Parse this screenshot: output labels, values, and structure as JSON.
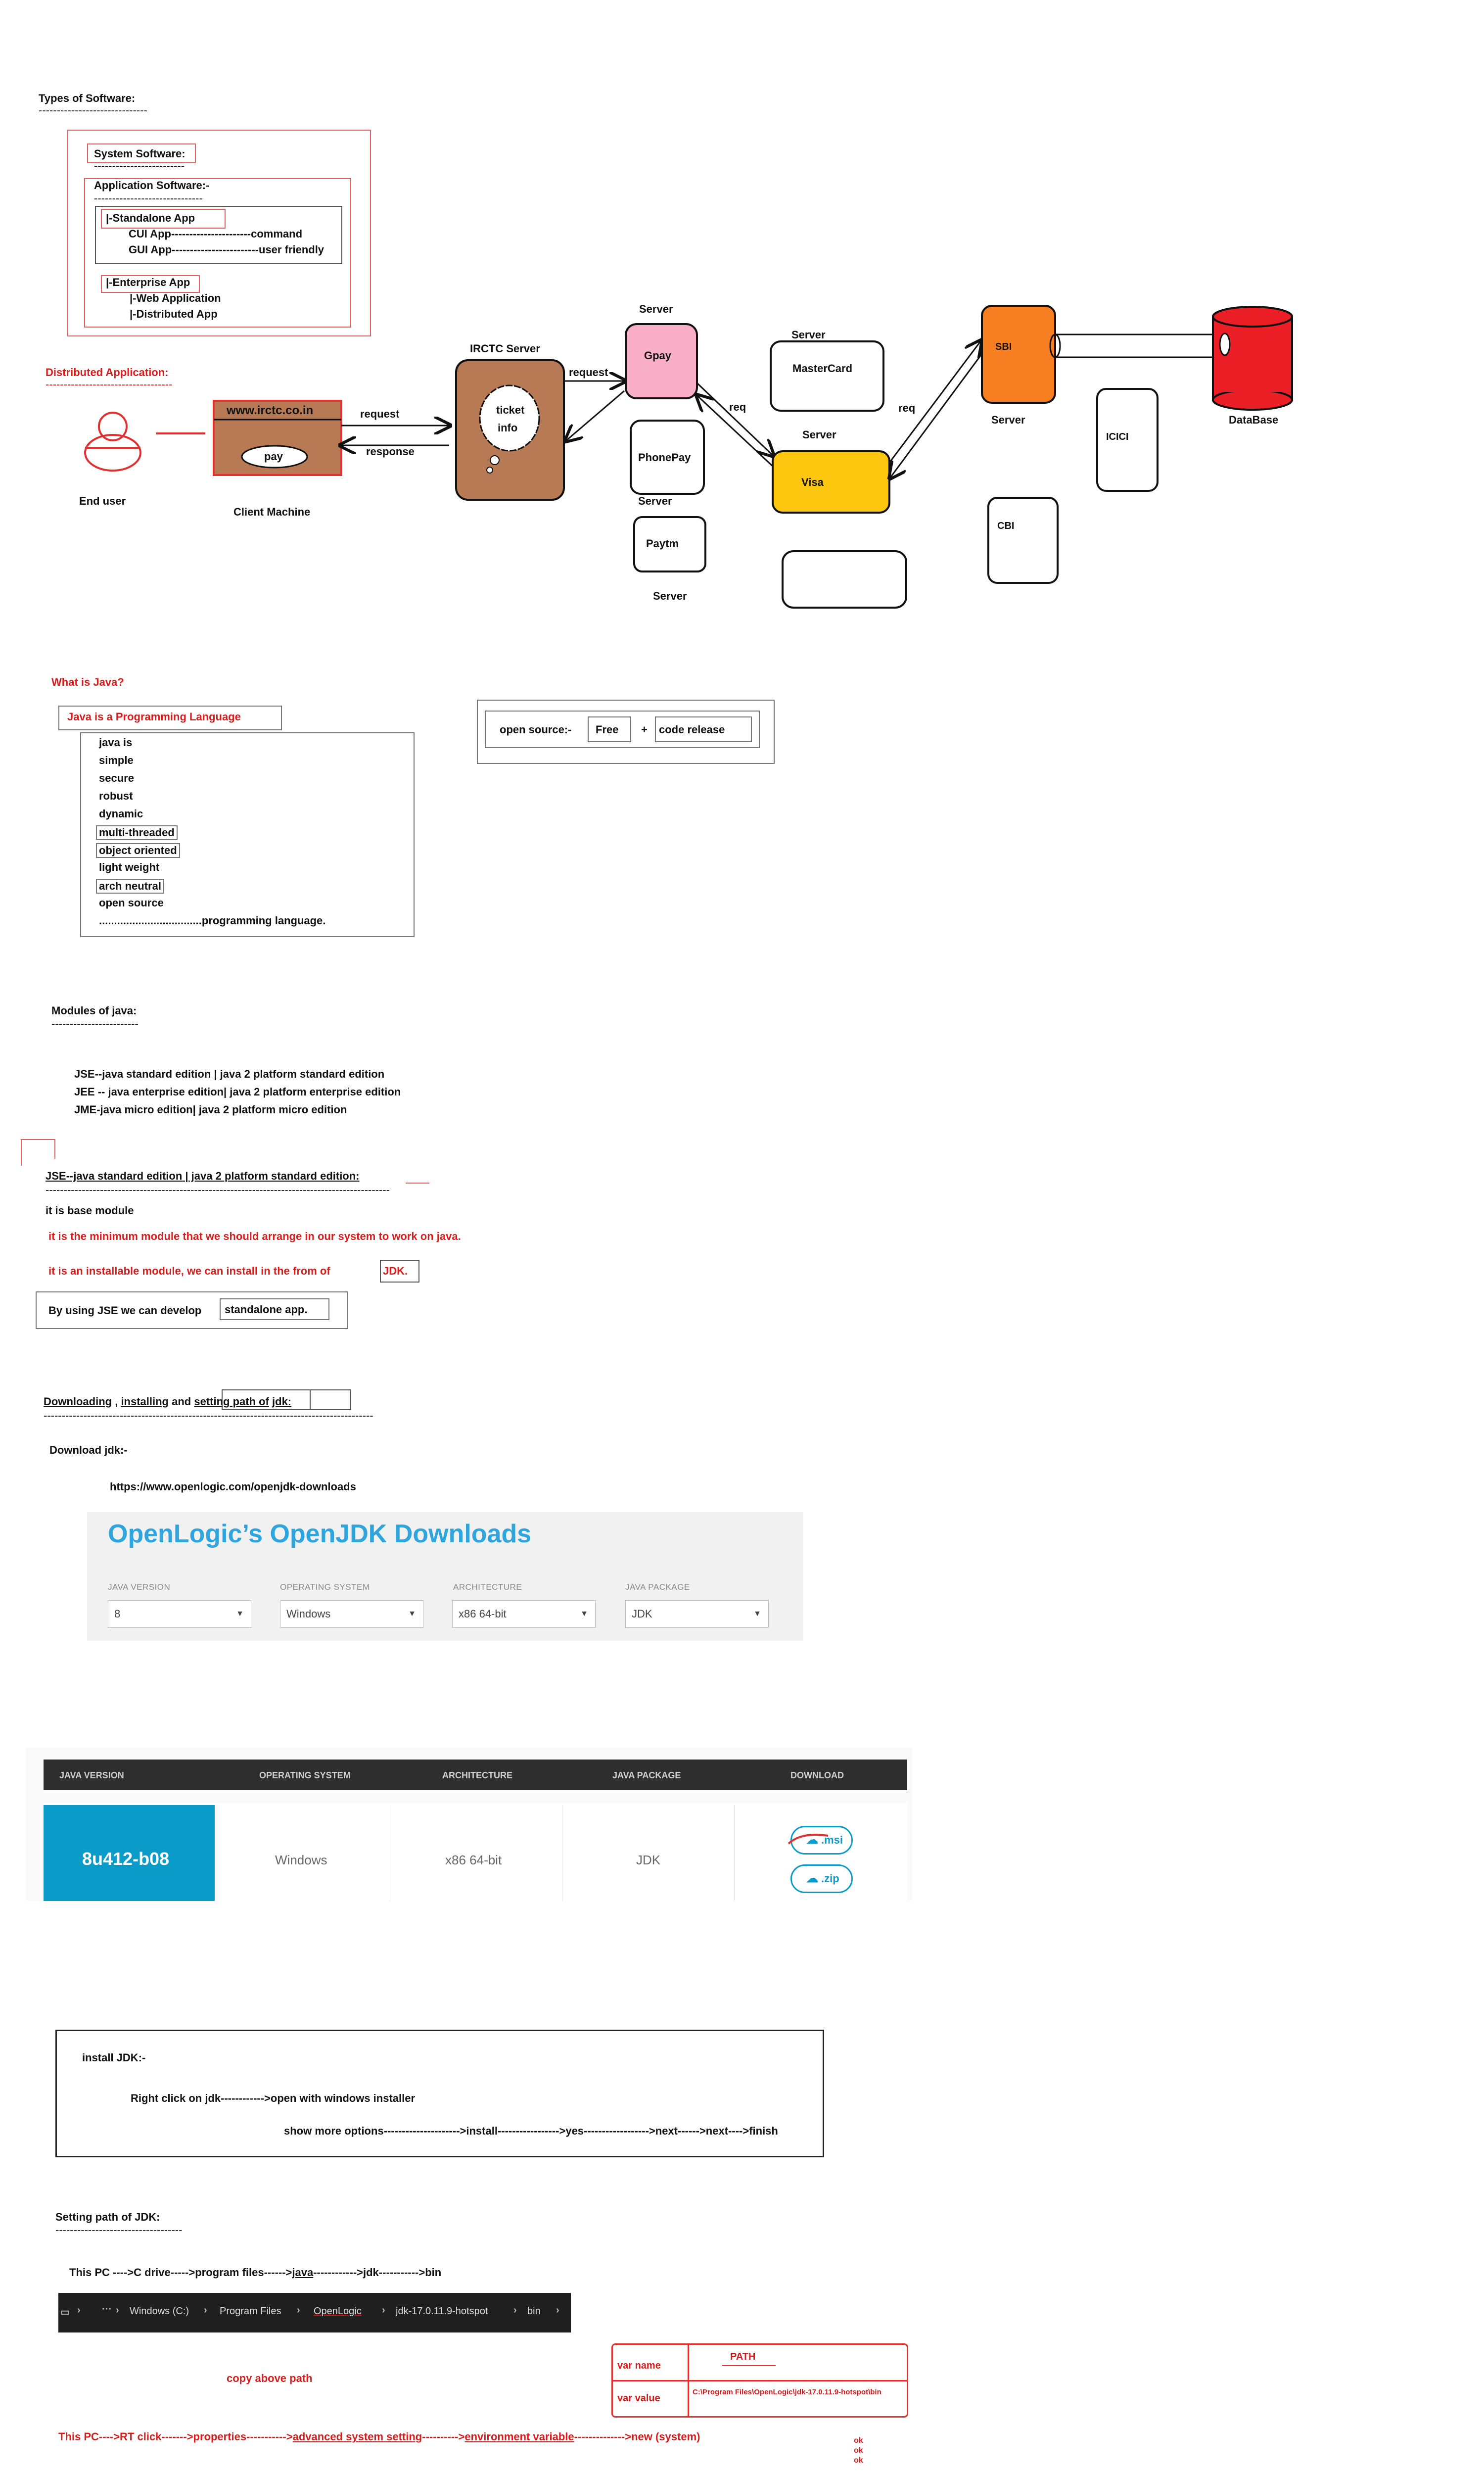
{
  "types": {
    "title": "Types of Software:",
    "dashes": "------------------------------",
    "system": "System Software:",
    "system_dashes": "-------------------------",
    "application": "Application Software:-",
    "app_dashes": "------------------------------",
    "standalone": "|-Standalone App",
    "cui": "CUI  App----------------------command",
    "gui": "GUI App------------------------user friendly",
    "enterprise": "|-Enterprise App",
    "web": "|-Web Application",
    "distributed": "|-Distributed App"
  },
  "distributed": {
    "title": "Distributed Application:",
    "dashes": "-----------------------------------",
    "end_user": "End user",
    "client_machine": "Client Machine",
    "url": "www.irctc.co.in",
    "pay": "pay",
    "request": "request",
    "response": "response",
    "irctc_server": "IRCTC Server",
    "ticket": "ticket",
    "info": "info",
    "request2": "request",
    "server": "Server",
    "gpay": "Gpay",
    "phonepay": "PhonePay",
    "paytm": "Paytm",
    "mastercard": "MasterCard",
    "visa": "Visa",
    "req": "req",
    "sbi": "SBI",
    "icici": "ICICI",
    "cbi": "CBI",
    "database": "DataBase"
  },
  "java": {
    "title": "What is Java?",
    "is_lang": "Java is a Programming  Language",
    "features": [
      "java is",
      "simple",
      "secure",
      "robust",
      "dynamic",
      "multi-threaded",
      "object oriented",
      "light weight",
      "arch neutral",
      "open source",
      "..................................programming language."
    ],
    "open_source": "open source:-",
    "free": "Free",
    "plus": "+",
    "code_release": "code release"
  },
  "modules": {
    "title": "Modules of java:",
    "dashes": "------------------------",
    "jse": "JSE--java standard edition  |  java 2 platform standard edition",
    "jee": "JEE -- java enterprise edition|  java 2 platform  enterprise edition",
    "jme": "JME-java micro edition|  java 2 platform micro edition"
  },
  "jse": {
    "title": "JSE--java standard edition  |  java 2 platform standard edition:",
    "dashes": "-----------------------------------------------------------------------------------------------",
    "base": "it is base module",
    "min": "it  is the minimum module that we should arrange in our system to work on java.",
    "installable": "it is an installable module, we can install in the from of",
    "jdk": "JDK.",
    "develop": "By using JSE we can develop",
    "standalone": "standalone app."
  },
  "download": {
    "word1": "Downloading",
    "sep1": " , ",
    "word2": "installing",
    "sep2": "  and ",
    "word3": "setting path of",
    "word4": "jdk:",
    "dashes": "-------------------------------------------------------------------------------------------",
    "label": "Download jdk:-",
    "url": "https://www.openlogic.com/openjdk-downloads"
  },
  "openlogic": {
    "title": "OpenLogic’s OpenJDK Downloads",
    "labels": [
      "JAVA VERSION",
      "OPERATING SYSTEM",
      "ARCHITECTURE",
      "JAVA PACKAGE"
    ],
    "values": [
      "8",
      "Windows",
      "x86 64-bit",
      "JDK"
    ]
  },
  "table": {
    "headers": [
      "JAVA VERSION",
      "OPERATING SYSTEM",
      "ARCHITECTURE",
      "JAVA PACKAGE",
      "DOWNLOAD"
    ],
    "version": "8u412-b08",
    "os": "Windows",
    "arch": "x86 64-bit",
    "pkg": "JDK",
    "msi": ".msi",
    "zip": ".zip",
    "accent": "#0a9bc9"
  },
  "install": {
    "title": "install JDK:-",
    "line1": "Right click on jdk------------>open with windows installer",
    "line2": "show more options--------------------->install----------------->yes------------------>next------>next---->finish"
  },
  "path": {
    "title": "Setting  path of JDK:",
    "dashes": "-----------------------------------",
    "pc": "This PC ---->C drive----->program files------>",
    "java": "java",
    "arrow": "------------>",
    "jdk": "jdk",
    "bin": "----------->bin",
    "breadcrumb": [
      "Windows (C:)",
      "Program Files",
      "OpenLogic",
      "jdk-17.0.11.9-hotspot",
      "bin"
    ],
    "copy": "copy above path",
    "var_name_label": "var name",
    "var_name": "PATH",
    "var_value_label": "var  value",
    "var_value": "C:\\Program Files\\OpenLogic\\jdk-17.0.11.9-hotspot\\bin",
    "prefix": "This PC---->RT click------->properties----------->",
    "adv": "advanced system setting",
    "mid": "---------->",
    "env": "environment variable",
    "suffix": "-------------->new (system)",
    "oks": [
      "ok",
      "ok",
      "ok"
    ]
  }
}
